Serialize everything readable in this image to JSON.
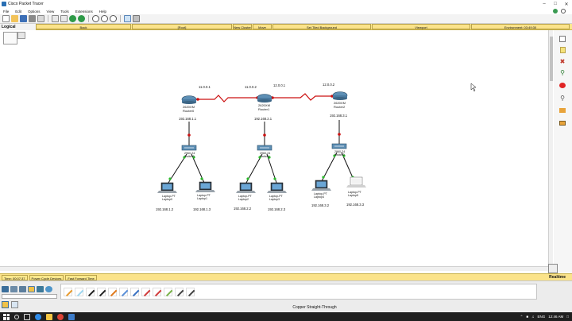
{
  "window": {
    "title": "Cisco Packet Tracer"
  },
  "menu": [
    "File",
    "Edit",
    "Options",
    "View",
    "Tools",
    "Extensions",
    "Help"
  ],
  "workspace_bar": {
    "mode": "Logical",
    "root_label": "[Root]",
    "back_label": "Back",
    "new_cluster": "New Cluster",
    "move_object": "Move Object",
    "set_background": "Set Tiled Background",
    "viewport": "Viewport",
    "environment": "Environment: 03:49:30"
  },
  "topology": {
    "routers": [
      {
        "id": "router0",
        "model": "2620XM",
        "name": "Router0",
        "ip_label": "192.168.1.1"
      },
      {
        "id": "router1",
        "model": "2620XM",
        "name": "Router1",
        "ip_label": "192.168.2.1"
      },
      {
        "id": "router2",
        "model": "2620XM",
        "name": "Router2",
        "ip_label": "192.168.3.1"
      }
    ],
    "wan_labels": [
      "11.0.0.1",
      "11.0.0.2",
      "12.0.0.1",
      "12.0.0.2"
    ],
    "switches": [
      {
        "id": "switch0",
        "model": "2960-24",
        "name": "Switch0"
      },
      {
        "id": "switch1",
        "model": "2960-24",
        "name": "Switch1"
      },
      {
        "id": "switch2",
        "model": "2960-24",
        "name": "Switch2"
      }
    ],
    "laptops": [
      {
        "id": "laptop0",
        "model": "Laptop-PT",
        "name": "Laptop0",
        "ip": "192.168.1.2"
      },
      {
        "id": "laptop1",
        "model": "Laptop-PT",
        "name": "Laptop1",
        "ip": "192.168.1.3"
      },
      {
        "id": "laptop2",
        "model": "Laptop-PT",
        "name": "Laptop2",
        "ip": "192.168.2.2"
      },
      {
        "id": "laptop3",
        "model": "Laptop-PT",
        "name": "Laptop3",
        "ip": "192.168.2.3"
      },
      {
        "id": "laptop4",
        "model": "Laptop-PT",
        "name": "Laptop4",
        "ip": "192.168.3.2"
      },
      {
        "id": "laptop5",
        "model": "Laptop-PT",
        "name": "Laptop5",
        "ip": "192.168.3.3"
      }
    ]
  },
  "status": {
    "time": "Time: 00:07:37",
    "power_cycle": "Power Cycle Devices",
    "fast_forward": "Fast Forward Time",
    "mode": "Realtime"
  },
  "cable_selection": "Copper Straight-Through",
  "cables": [
    {
      "name": "automatic-icon",
      "color": "#e89b2e"
    },
    {
      "name": "console-icon",
      "color": "#9fd6ef"
    },
    {
      "name": "copper-straight-icon",
      "color": "#222222"
    },
    {
      "name": "copper-cross-icon",
      "color": "#222222"
    },
    {
      "name": "fiber-icon",
      "color": "#e07a1c"
    },
    {
      "name": "phone-icon",
      "color": "#5a8fd8"
    },
    {
      "name": "coaxial-icon",
      "color": "#3770c2"
    },
    {
      "name": "serial-dce-icon",
      "color": "#d13b3b"
    },
    {
      "name": "serial-dte-icon",
      "color": "#d13b3b"
    },
    {
      "name": "octal-icon",
      "color": "#7ab34a"
    },
    {
      "name": "iot-icon",
      "color": "#444444"
    },
    {
      "name": "usb-icon",
      "color": "#444444"
    }
  ],
  "taskbar": {
    "language": "ENG",
    "time": "12:46 AM"
  },
  "colors": {
    "serial_link": "#cc1111",
    "ethernet_link": "#111111",
    "link_up": "#2bbb2b",
    "link_down": "#cc1111",
    "workspace_bar": "#fde98c"
  }
}
